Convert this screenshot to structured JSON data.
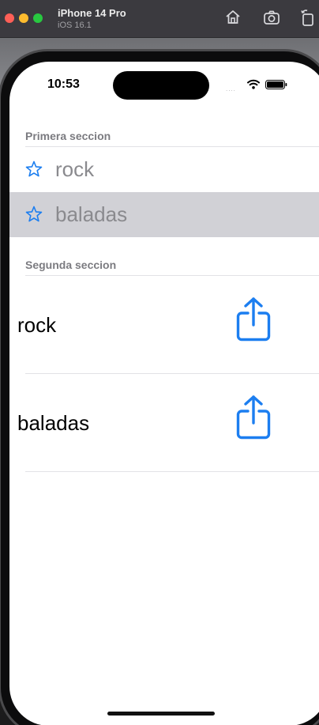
{
  "simulator": {
    "device_name": "iPhone 14 Pro",
    "os_version": "iOS 16.1"
  },
  "status_bar": {
    "time": "10:53",
    "signal_dots": "....",
    "icons": [
      "wifi-icon",
      "battery-icon"
    ]
  },
  "sections": [
    {
      "header": "Primera seccion",
      "rows": [
        {
          "label": "rock",
          "icon": "star-icon",
          "selected": false
        },
        {
          "label": "baladas",
          "icon": "star-icon",
          "selected": true
        }
      ]
    },
    {
      "header": "Segunda seccion",
      "rows": [
        {
          "label": "rock",
          "icon": "share-icon"
        },
        {
          "label": "baladas",
          "icon": "share-icon"
        }
      ]
    }
  ],
  "colors": {
    "accent": "#1c7ef0",
    "selected_row": "#d1d1d6",
    "section_header": "#7b7b80",
    "muted_label": "#8a8a8e"
  }
}
